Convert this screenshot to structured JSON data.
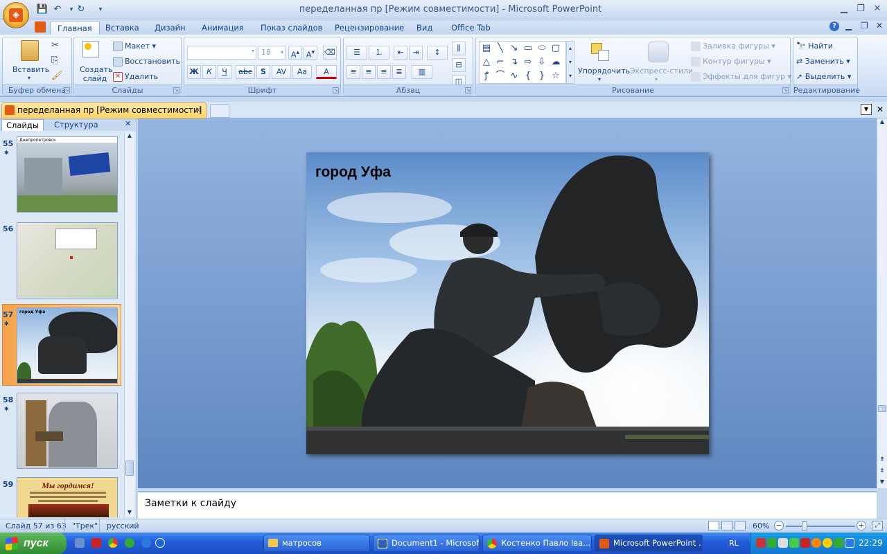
{
  "window": {
    "title": "переделанная пр [Режим совместимости] - Microsoft PowerPoint"
  },
  "ribbon_tabs": [
    "Главная",
    "Вставка",
    "Дизайн",
    "Анимация",
    "Показ слайдов",
    "Рецензирование",
    "Вид",
    "Office Tab"
  ],
  "groups": {
    "clipboard": {
      "label": "Буфер обмена",
      "paste": "Вставить"
    },
    "slides": {
      "label": "Слайды",
      "new_slide": "Создать слайд",
      "layout": "Макет",
      "reset": "Восстановить",
      "delete": "Удалить"
    },
    "font": {
      "label": "Шрифт",
      "size": "18"
    },
    "paragraph": {
      "label": "Абзац"
    },
    "drawing": {
      "label": "Рисование",
      "arrange": "Упорядочить",
      "quick_styles": "Экспресс-стили",
      "fill": "Заливка фигуры",
      "outline": "Контур фигуры",
      "effects": "Эффекты для фигур"
    },
    "editing": {
      "label": "Редактирование",
      "find": "Найти",
      "replace": "Заменить",
      "select": "Выделить"
    }
  },
  "doc_tab": {
    "label": "переделанная пр [Режим совместимости]"
  },
  "panel_tabs": {
    "slides": "Слайды",
    "outline": "Структура"
  },
  "thumbnails": [
    {
      "num": "55",
      "text": "Днепропетровск"
    },
    {
      "num": "56",
      "text": ""
    },
    {
      "num": "57",
      "text": "город Уфа"
    },
    {
      "num": "58",
      "text": ""
    },
    {
      "num": "59",
      "text": "Мы гордимся!"
    }
  ],
  "slide": {
    "title": "город Уфа"
  },
  "notes": {
    "placeholder": "Заметки к слайду"
  },
  "status": {
    "slide": "Слайд 57 из 63",
    "theme": "\"Трек\"",
    "lang": "русский",
    "zoom": "60%"
  },
  "taskbar": {
    "start": "пуск",
    "tasks": [
      "матросов",
      "Document1 - Microsof...",
      "Костенко Павло Іва...",
      "Microsoft PowerPoint ..."
    ],
    "lang": "RL",
    "clock": "22:29"
  }
}
